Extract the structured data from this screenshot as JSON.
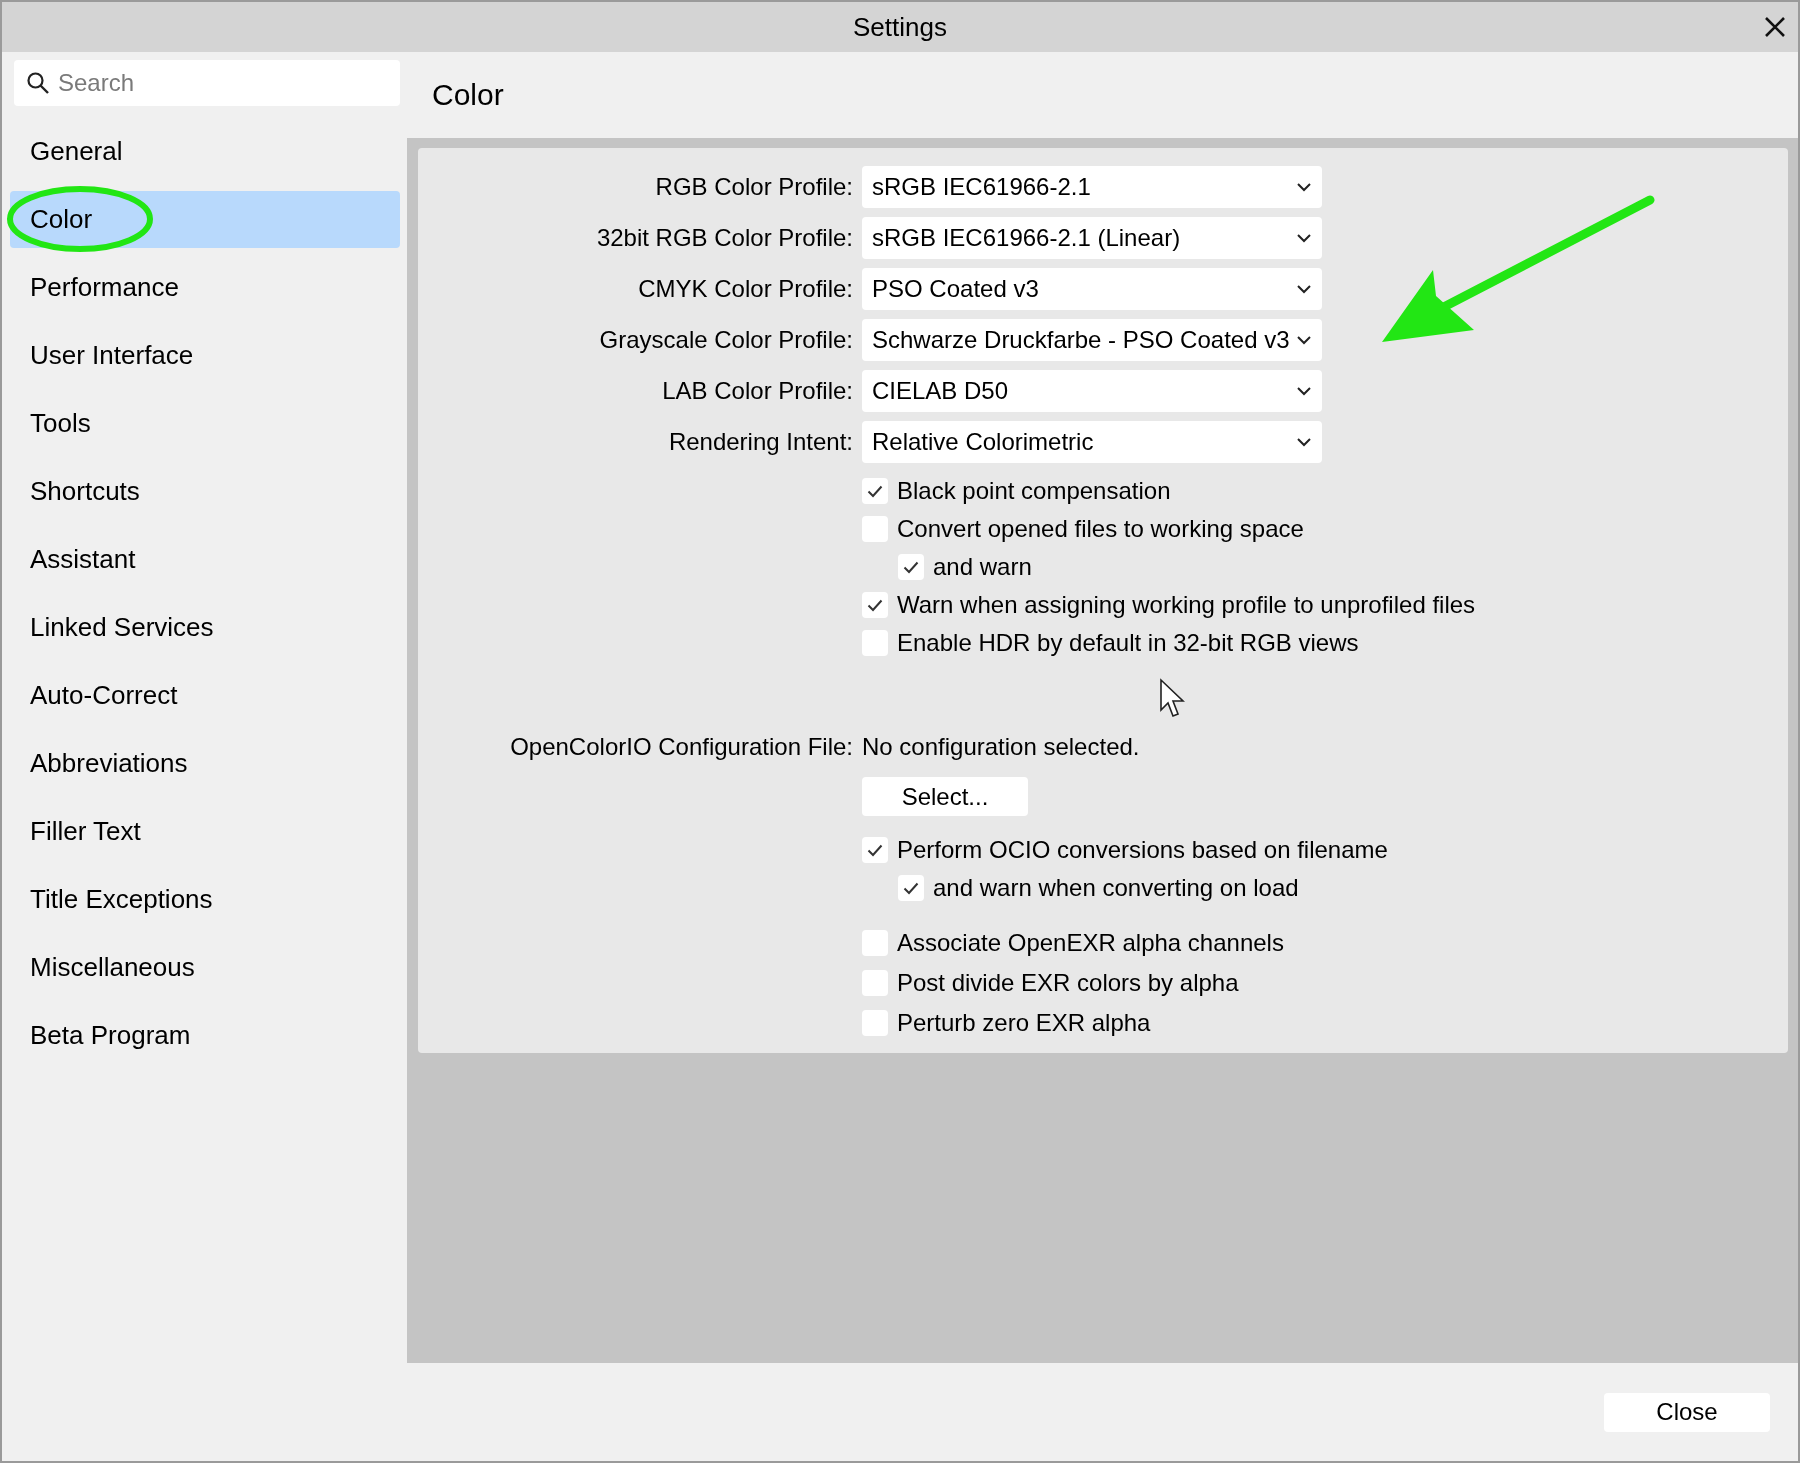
{
  "window": {
    "title": "Settings"
  },
  "sidebar": {
    "search": {
      "placeholder": "Search"
    },
    "items": [
      {
        "label": "General",
        "selected": false
      },
      {
        "label": "Color",
        "selected": true
      },
      {
        "label": "Performance",
        "selected": false
      },
      {
        "label": "User Interface",
        "selected": false
      },
      {
        "label": "Tools",
        "selected": false
      },
      {
        "label": "Shortcuts",
        "selected": false
      },
      {
        "label": "Assistant",
        "selected": false
      },
      {
        "label": "Linked Services",
        "selected": false
      },
      {
        "label": "Auto-Correct",
        "selected": false
      },
      {
        "label": "Abbreviations",
        "selected": false
      },
      {
        "label": "Filler Text",
        "selected": false
      },
      {
        "label": "Title Exceptions",
        "selected": false
      },
      {
        "label": "Miscellaneous",
        "selected": false
      },
      {
        "label": "Beta Program",
        "selected": false
      }
    ]
  },
  "page": {
    "heading": "Color",
    "profiles": [
      {
        "label": "RGB Color Profile:",
        "value": "sRGB IEC61966-2.1"
      },
      {
        "label": "32bit RGB Color Profile:",
        "value": "sRGB IEC61966-2.1 (Linear)"
      },
      {
        "label": "CMYK Color Profile:",
        "value": "PSO Coated v3"
      },
      {
        "label": "Grayscale Color Profile:",
        "value": "Schwarze Druckfarbe - PSO Coated v3"
      },
      {
        "label": "LAB Color Profile:",
        "value": "CIELAB D50"
      },
      {
        "label": "Rendering Intent:",
        "value": "Relative Colorimetric"
      }
    ],
    "profile_options": [
      {
        "label": "Black point compensation",
        "checked": true
      },
      {
        "label": "Convert opened files to working space",
        "checked": false,
        "children": [
          {
            "label": "and warn",
            "checked": true
          }
        ]
      },
      {
        "label": "Warn when assigning working profile to unprofiled files",
        "checked": true
      },
      {
        "label": "Enable HDR by default in 32-bit RGB views",
        "checked": false
      }
    ],
    "ocio": {
      "label": "OpenColorIO Configuration File:",
      "value": "No configuration selected.",
      "button": "Select..."
    },
    "ocio_options": [
      {
        "label": "Perform OCIO conversions based on filename",
        "checked": true,
        "children": [
          {
            "label": "and warn when converting on load",
            "checked": true
          }
        ]
      }
    ],
    "exr_options": [
      {
        "label": "Associate OpenEXR alpha channels",
        "checked": false
      },
      {
        "label": "Post divide EXR colors by alpha",
        "checked": false
      },
      {
        "label": "Perturb zero EXR alpha",
        "checked": false
      }
    ]
  },
  "footer": {
    "button": "Close"
  }
}
